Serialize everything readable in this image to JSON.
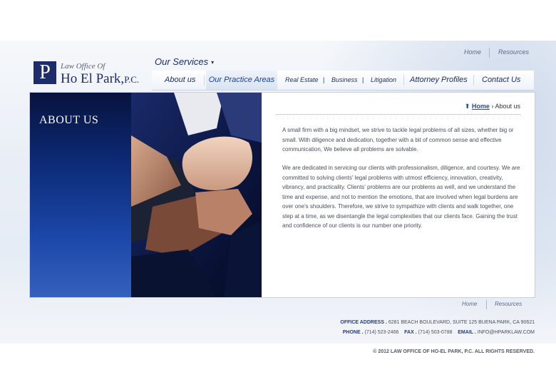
{
  "logo": {
    "mark": "P",
    "line1": "Law Office Of",
    "name": "Ho El Park,",
    "suffix": "P.C."
  },
  "our_services": "Our Services",
  "top_links": {
    "home": "Home",
    "resources": "Resources"
  },
  "nav": {
    "about": "About us",
    "practice": "Our Practice Areas",
    "real_estate": "Real Estate",
    "business": "Business",
    "litigation": "Litigation",
    "pipe": "|",
    "attorney": "Attorney Profiles",
    "contact": "Contact Us"
  },
  "page": {
    "heading": "ABOUT US"
  },
  "breadcrumb": {
    "home": "Home",
    "current": "About us",
    "separator": "›"
  },
  "paragraphs": [
    "A small firm with a big mindset, we strive to tackle legal problems of all sizes, whether big or small. With diligence and dedication, together with a bit of common sense and effective communication, We believe all problems are solvable.",
    "We are dedicated in servicing our clients with professionalism, diligence, and courtesy. We are committed to solving clients' legal problems with utmost efficiency, innovation, creativity, vibrancy, and practicality. Clients' problems are our problems as well, and we understand the time and expense, and not to mention the emotions, that are involved when legal burdens are over one's shoulders. Therefore, we strive to sympathize with clients and walk together, one step at a time, as we disentangle the legal complexities that our clients face. Gaining the trust and confidence of our clients is our number one priority."
  ],
  "bottom_links": {
    "home": "Home",
    "resources": "Resources"
  },
  "footer": {
    "office_label": "OFFICE ADDRESS .",
    "office_value": "6281 BEACH BOULEVARD, SUITE 125 BUENA PARK, CA 90621",
    "phone_label": "PHONE .",
    "phone_value": "(714) 523-2466",
    "fax_label": "FAX .",
    "fax_value": "(714) 503-0788",
    "email_label": "EMAIL .",
    "email_value": "INFO@HPARKLAW.COM",
    "copyright": "© 2012 LAW OFFICE OF HO-EL PARK, P.C. ALL RIGHTS RESERVED."
  },
  "colors": {
    "brand_navy": "#1d2c6b",
    "accent_blue": "#1d3f8f",
    "panel_dark": "#07133e"
  },
  "icons": {
    "breadcrumb_home": "home-arrow-icon",
    "dropdown": "caret-down-icon"
  }
}
